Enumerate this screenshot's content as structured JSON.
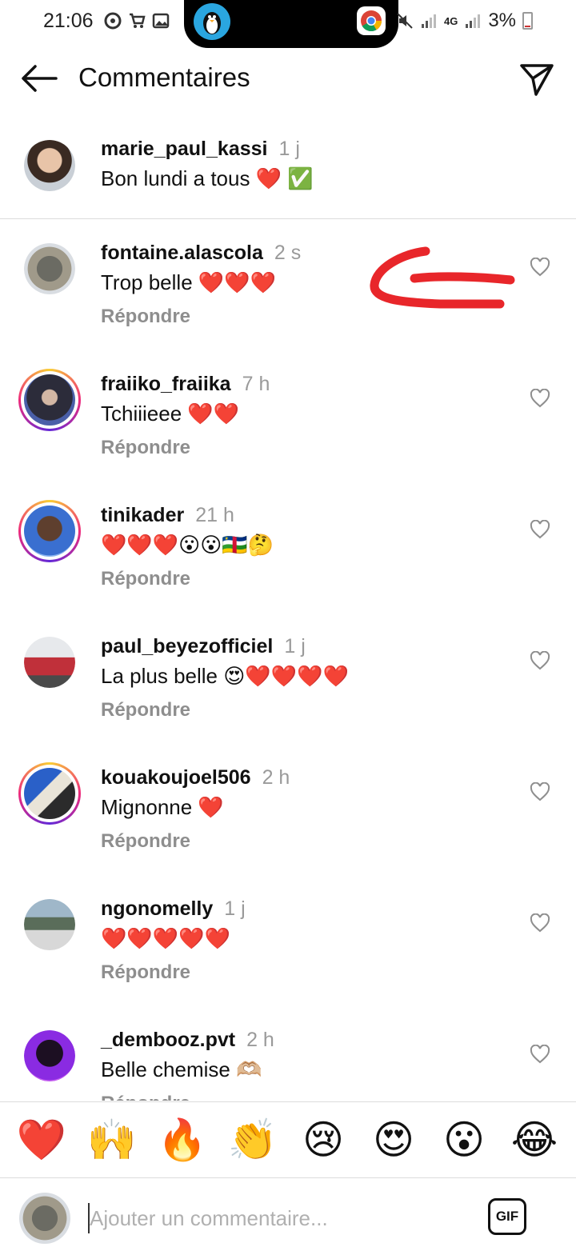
{
  "status_bar": {
    "time": "21:06",
    "network": "4G",
    "battery": "3%"
  },
  "header": {
    "title": "Commentaires"
  },
  "caption": {
    "username": "marie_paul_kassi",
    "time": "1 j",
    "text": "Bon lundi a tous ❤️ ✅"
  },
  "comments": [
    {
      "username": "fontaine.alascola",
      "time": "2 s",
      "text": "Trop belle ❤️❤️❤️",
      "reply": "Répondre"
    },
    {
      "username": "fraiiko_fraiika",
      "time": "7 h",
      "text": "Tchiiieee ❤️❤️",
      "reply": "Répondre"
    },
    {
      "username": "tinikader",
      "time": "21 h",
      "text": "❤️❤️❤️😮😮🇨🇫🤔",
      "reply": "Répondre"
    },
    {
      "username": "paul_beyezofficiel",
      "time": "1 j",
      "text": "La plus belle 😍❤️❤️❤️❤️",
      "reply": "Répondre"
    },
    {
      "username": "kouakoujoel506",
      "time": "2 h",
      "text": "Mignonne ❤️",
      "reply": "Répondre"
    },
    {
      "username": "ngonomelly",
      "time": "1 j",
      "text": "❤️❤️❤️❤️❤️",
      "reply": "Répondre"
    },
    {
      "username": "_dembooz.pvt",
      "time": "2 h",
      "text": "Belle chemise 🫶🏼",
      "reply": "Répondre"
    }
  ],
  "emoji_bar": [
    "❤️",
    "🙌",
    "🔥",
    "👏",
    "😢",
    "😍",
    "😮",
    "😂"
  ],
  "input": {
    "placeholder": "Ajouter un commentaire...",
    "gif_label": "GIF"
  },
  "colors": {
    "text": "#111111",
    "secondary": "#8e8e8e",
    "divider": "#dcdcdc",
    "annotation": "#e8262a"
  }
}
